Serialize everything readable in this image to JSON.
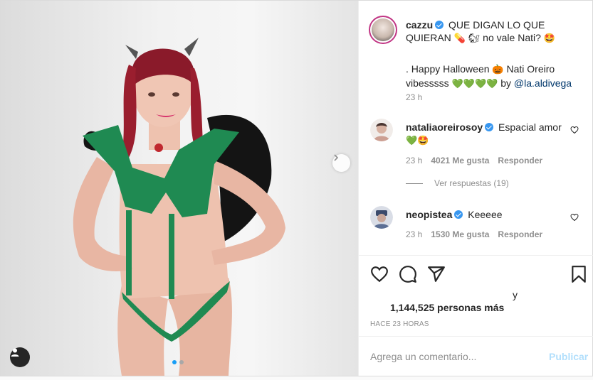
{
  "post": {
    "author": "cazzu",
    "caption_line1": "QUE DIGAN LO QUE QUIERAN",
    "caption_line1_tail": "no vale Nati?",
    "caption_line2": ". Happy Halloween",
    "caption_line2b": "Nati Oreiro vibesssss",
    "caption_by": "by",
    "caption_mention": "@la.aldivega",
    "caption_time": "23 h",
    "emoji_pill": "💊",
    "emoji_dog": "🐿",
    "emoji_face": "🤩",
    "emoji_pumpkin": "🎃",
    "emoji_hearts": "💚💚💚💚"
  },
  "comments": [
    {
      "username": "nataliaoreirosoy",
      "text": "Espacial amor",
      "emoji": "💚🤩",
      "time": "23 h",
      "likes": "4021 Me gusta",
      "reply": "Responder"
    },
    {
      "username": "neopistea",
      "text": "Keeeee",
      "time": "23 h",
      "likes": "1530 Me gusta",
      "reply": "Responder"
    }
  ],
  "view_replies": "Ver respuestas (19)",
  "likes": {
    "conjunction": "y",
    "count_text": "1,144,525 personas más"
  },
  "age": "HACE 23 HORAS",
  "composer": {
    "placeholder": "Agrega un comentario...",
    "publish": "Publicar"
  },
  "carousel": {
    "slides": 2,
    "current": 1
  },
  "colors": {
    "accent": "#0095f6",
    "verified": "#3897f0",
    "publish_disabled": "#b2dffc",
    "mention": "#00376b",
    "secondary_text": "#8e8e8e"
  },
  "icons": [
    "heart-icon",
    "comment-icon",
    "share-icon",
    "bookmark-icon",
    "chevron-right-icon",
    "user-tag-icon",
    "verified-badge-icon"
  ]
}
